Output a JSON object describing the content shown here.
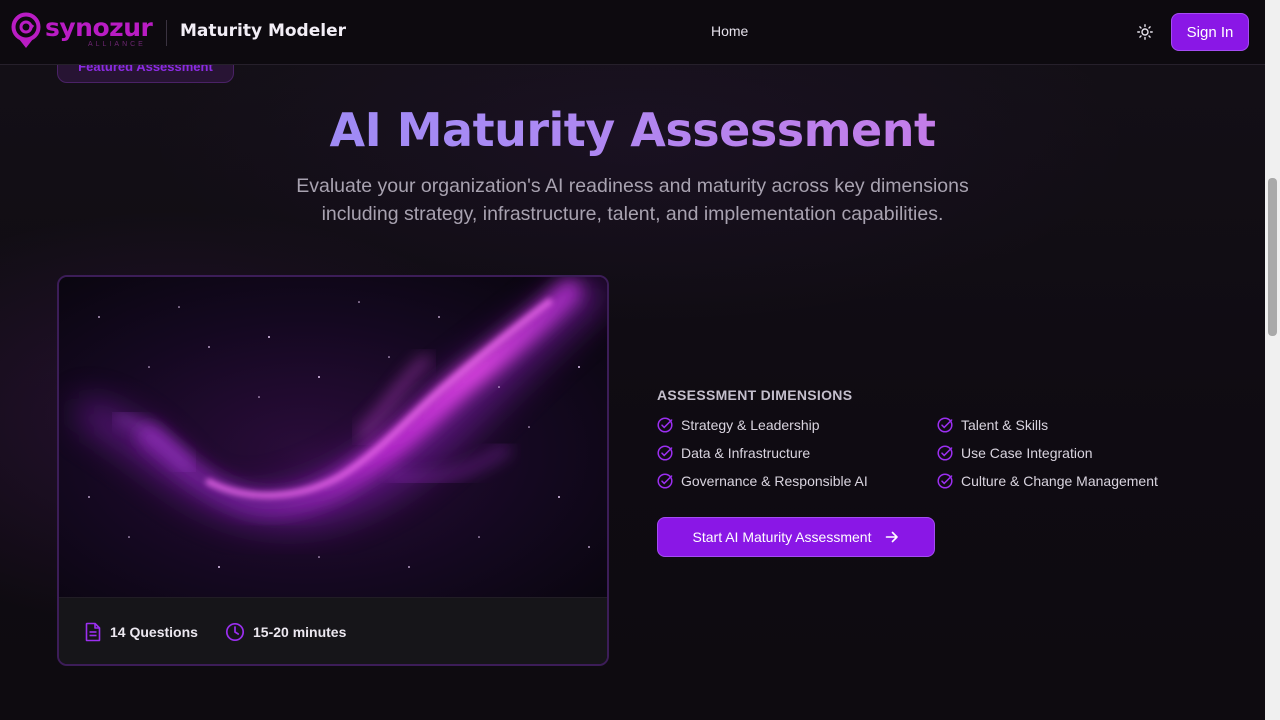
{
  "brand": {
    "name": "synozur",
    "tagline": "ALLIANCE",
    "app_title": "Maturity Modeler",
    "accent": "#8a17e6",
    "logo_color": "#b91cc4"
  },
  "nav": {
    "home": "Home",
    "theme_icon": "sun-icon",
    "sign_in": "Sign In"
  },
  "hero": {
    "badge": "Featured Assessment",
    "title": "AI Maturity Assessment",
    "subtitle_line1": "Evaluate your organization's AI readiness and maturity across key dimensions",
    "subtitle_line2": "including strategy, infrastructure, talent, and implementation capabilities."
  },
  "card": {
    "questions": "14 Questions",
    "duration": "15-20 minutes",
    "question_icon": "document-icon",
    "duration_icon": "clock-icon"
  },
  "dimensions": {
    "heading": "ASSESSMENT DIMENSIONS",
    "items": [
      "Strategy & Leadership",
      "Talent & Skills",
      "Data & Infrastructure",
      "Use Case Integration",
      "Governance & Responsible AI",
      "Culture & Change Management"
    ]
  },
  "cta": {
    "label": "Start AI Maturity Assessment",
    "icon": "arrow-right-icon"
  }
}
